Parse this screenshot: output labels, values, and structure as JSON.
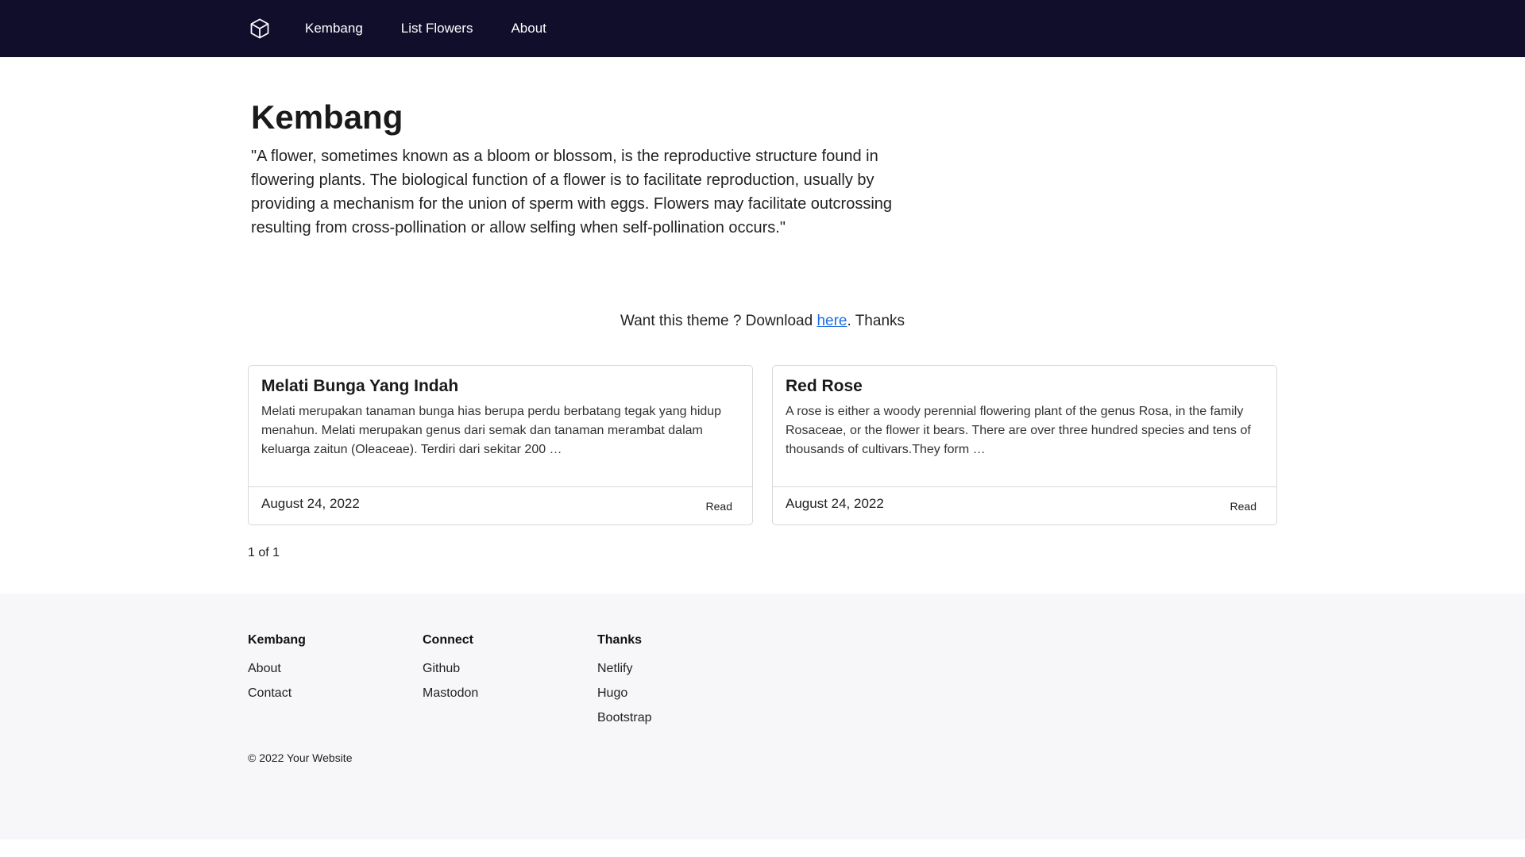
{
  "nav": {
    "logo_icon": "cube-icon",
    "items": [
      {
        "label": "Kembang"
      },
      {
        "label": "List Flowers"
      },
      {
        "label": "About"
      }
    ]
  },
  "hero": {
    "title": "Kembang",
    "quote": "\"A flower, sometimes known as a bloom or blossom, is the reproductive structure found in flowering plants. The biological function of a flower is to facilitate reproduction, usually by providing a mechanism for the union of sperm with eggs. Flowers may facilitate outcrossing resulting from cross-pollination or allow selfing when self-pollination occurs.\""
  },
  "promo": {
    "prefix": "Want this theme ? Download ",
    "link": "here",
    "suffix": ". Thanks"
  },
  "posts": [
    {
      "title": "Melati Bunga Yang Indah",
      "excerpt": "Melati merupakan tanaman bunga hias berupa perdu berbatang tegak yang hidup menahun. Melati merupakan genus dari semak dan tanaman merambat dalam keluarga zaitun (Oleaceae). Terdiri dari sekitar 200 …",
      "date": "August 24, 2022",
      "read_label": "Read"
    },
    {
      "title": "Red Rose",
      "excerpt": "A rose is either a woody perennial flowering plant of the genus Rosa, in the family Rosaceae, or the flower it bears. There are over three hundred species and tens of thousands of cultivars.They form …",
      "date": "August 24, 2022",
      "read_label": "Read"
    }
  ],
  "pagination": "1 of 1",
  "footer": {
    "columns": [
      {
        "heading": "Kembang",
        "links": [
          "About",
          "Contact"
        ]
      },
      {
        "heading": "Connect",
        "links": [
          "Github",
          "Mastodon"
        ]
      },
      {
        "heading": "Thanks",
        "links": [
          "Netlify",
          "Hugo",
          "Bootstrap"
        ]
      }
    ],
    "copyright": "© 2022 Your Website"
  },
  "colors": {
    "navbar_bg": "#110e2c",
    "footer_bg": "#f7f7f9",
    "link": "#1f6fe0"
  }
}
